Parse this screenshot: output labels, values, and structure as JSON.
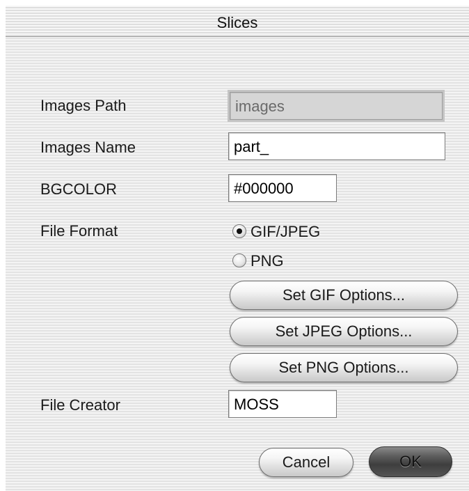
{
  "window": {
    "title": "Slices"
  },
  "fields": {
    "images_path": {
      "label": "Images Path",
      "value": "images"
    },
    "images_name": {
      "label": "Images Name",
      "value": "part_"
    },
    "bgcolor": {
      "label": "BGCOLOR",
      "value": "#000000"
    },
    "file_creator": {
      "label": "File Creator",
      "value": "MOSS"
    }
  },
  "file_format": {
    "label": "File Format",
    "options": [
      {
        "label": "GIF/JPEG",
        "selected": true
      },
      {
        "label": "PNG",
        "selected": false
      }
    ]
  },
  "option_buttons": {
    "gif": "Set GIF Options...",
    "jpeg": "Set JPEG Options...",
    "png": "Set PNG Options..."
  },
  "footer": {
    "cancel": "Cancel",
    "ok": "OK"
  }
}
